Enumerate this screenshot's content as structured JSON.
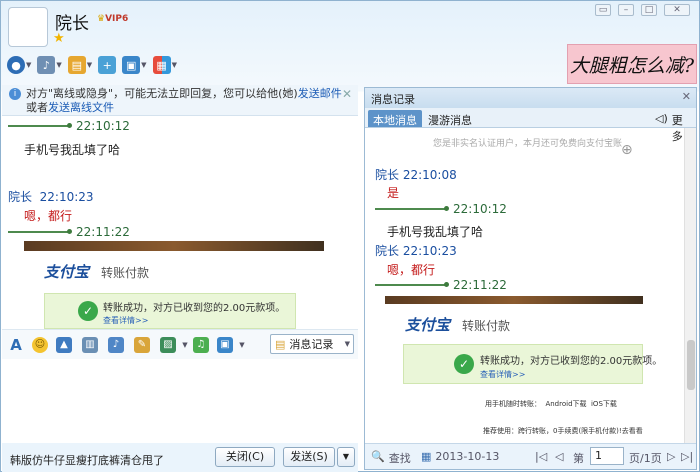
{
  "contact": {
    "name": "院长",
    "vip_label": "VIP6"
  },
  "banner_text": "大腿粗怎么减?",
  "notice": {
    "text_before": "对方\"离线或隐身\"，可能无法立即回复，您可以给他(她)",
    "link1": "发送邮件",
    "text_mid": "或者",
    "link2": "发送离线文件"
  },
  "chat": {
    "time1": "22:10:12",
    "msg1": "手机号我乱填了哈",
    "sender2": "院长",
    "time2": "22:10:23",
    "msg2": "嗯，都行",
    "time3": "22:11:22",
    "transfer": {
      "brand": "支付宝",
      "title": "转账付款",
      "success": "转账成功，对方已收到您的2.00元款项。",
      "detail": "查看详情>>"
    }
  },
  "format_toolbar": {
    "history_label": "消息记录"
  },
  "input_text": "韩版仿牛仔显瘦打底裤清仓甩了",
  "buttons": {
    "close": "关闭(C)",
    "send": "发送(S)"
  },
  "history": {
    "title": "消息记录",
    "tab_local": "本地消息",
    "tab_roam": "漫游消息",
    "more": "更多",
    "hint": "您是非实名认证用户，本月还可免费向支付宝账",
    "entries": [
      {
        "sender": "院长",
        "time": "22:10:08",
        "text": "是"
      },
      {
        "time": "22:10:12",
        "text": "手机号我乱填了哈"
      },
      {
        "sender": "院长",
        "time": "22:10:23",
        "text": "嗯，都行"
      },
      {
        "time": "22:11:22"
      }
    ],
    "transfer": {
      "brand": "支付宝",
      "title": "转账付款",
      "success": "转账成功，对方已收到您的2.00元款项。",
      "detail": "查看详情>>",
      "mobile": "用手机随时转账：",
      "android": "Android下载",
      "ios": "iOS下载",
      "recommend": "推荐使用：跨行转账，0手续费(限手机付款)!去看看"
    },
    "footer": {
      "search": "查找",
      "date": "2013-10-13",
      "page_prefix": "第",
      "page": "1",
      "page_suffix": "页/1页"
    }
  }
}
